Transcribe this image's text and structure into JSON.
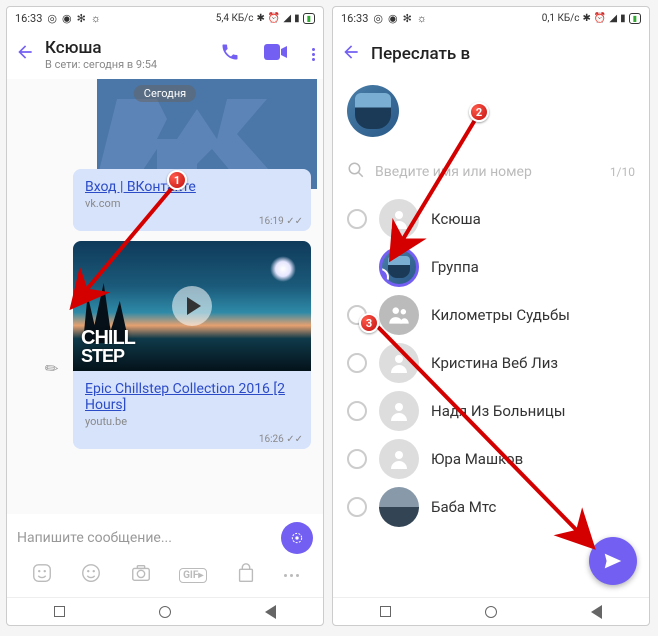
{
  "statusbar": {
    "time": "16:33",
    "data_rate_left": "5,4 КБ/с",
    "data_rate_right": "0,1 КБ/с"
  },
  "left": {
    "header": {
      "title": "Ксюша",
      "subtitle": "В сети: сегодня в 9:54"
    },
    "date": "Сегодня",
    "msg1": {
      "link": "Вход | ВКонтакте",
      "domain": "vk.com",
      "time": "16:19"
    },
    "msg2": {
      "overlay_line1": "CHILL",
      "overlay_line2": "STEP",
      "link": "Epic Chillstep Collection 2016 [2 Hours]",
      "domain": "youtu.be",
      "time": "16:26"
    },
    "input_placeholder": "Напишите сообщение...",
    "gif_label": "GIF"
  },
  "right": {
    "title": "Переслать в",
    "search_placeholder": "Введите имя или номер",
    "counter": "1/10",
    "contacts": [
      {
        "name": "Ксюша"
      },
      {
        "name": "Группа"
      },
      {
        "name": "Километры Судьбы"
      },
      {
        "name": "Кристина Веб Лиз"
      },
      {
        "name": "Надя Из Больницы"
      },
      {
        "name": "Юра Машков"
      },
      {
        "name": "Баба Мтс"
      }
    ]
  },
  "annotations": {
    "badge1": "1",
    "badge2": "2",
    "badge3": "3"
  }
}
